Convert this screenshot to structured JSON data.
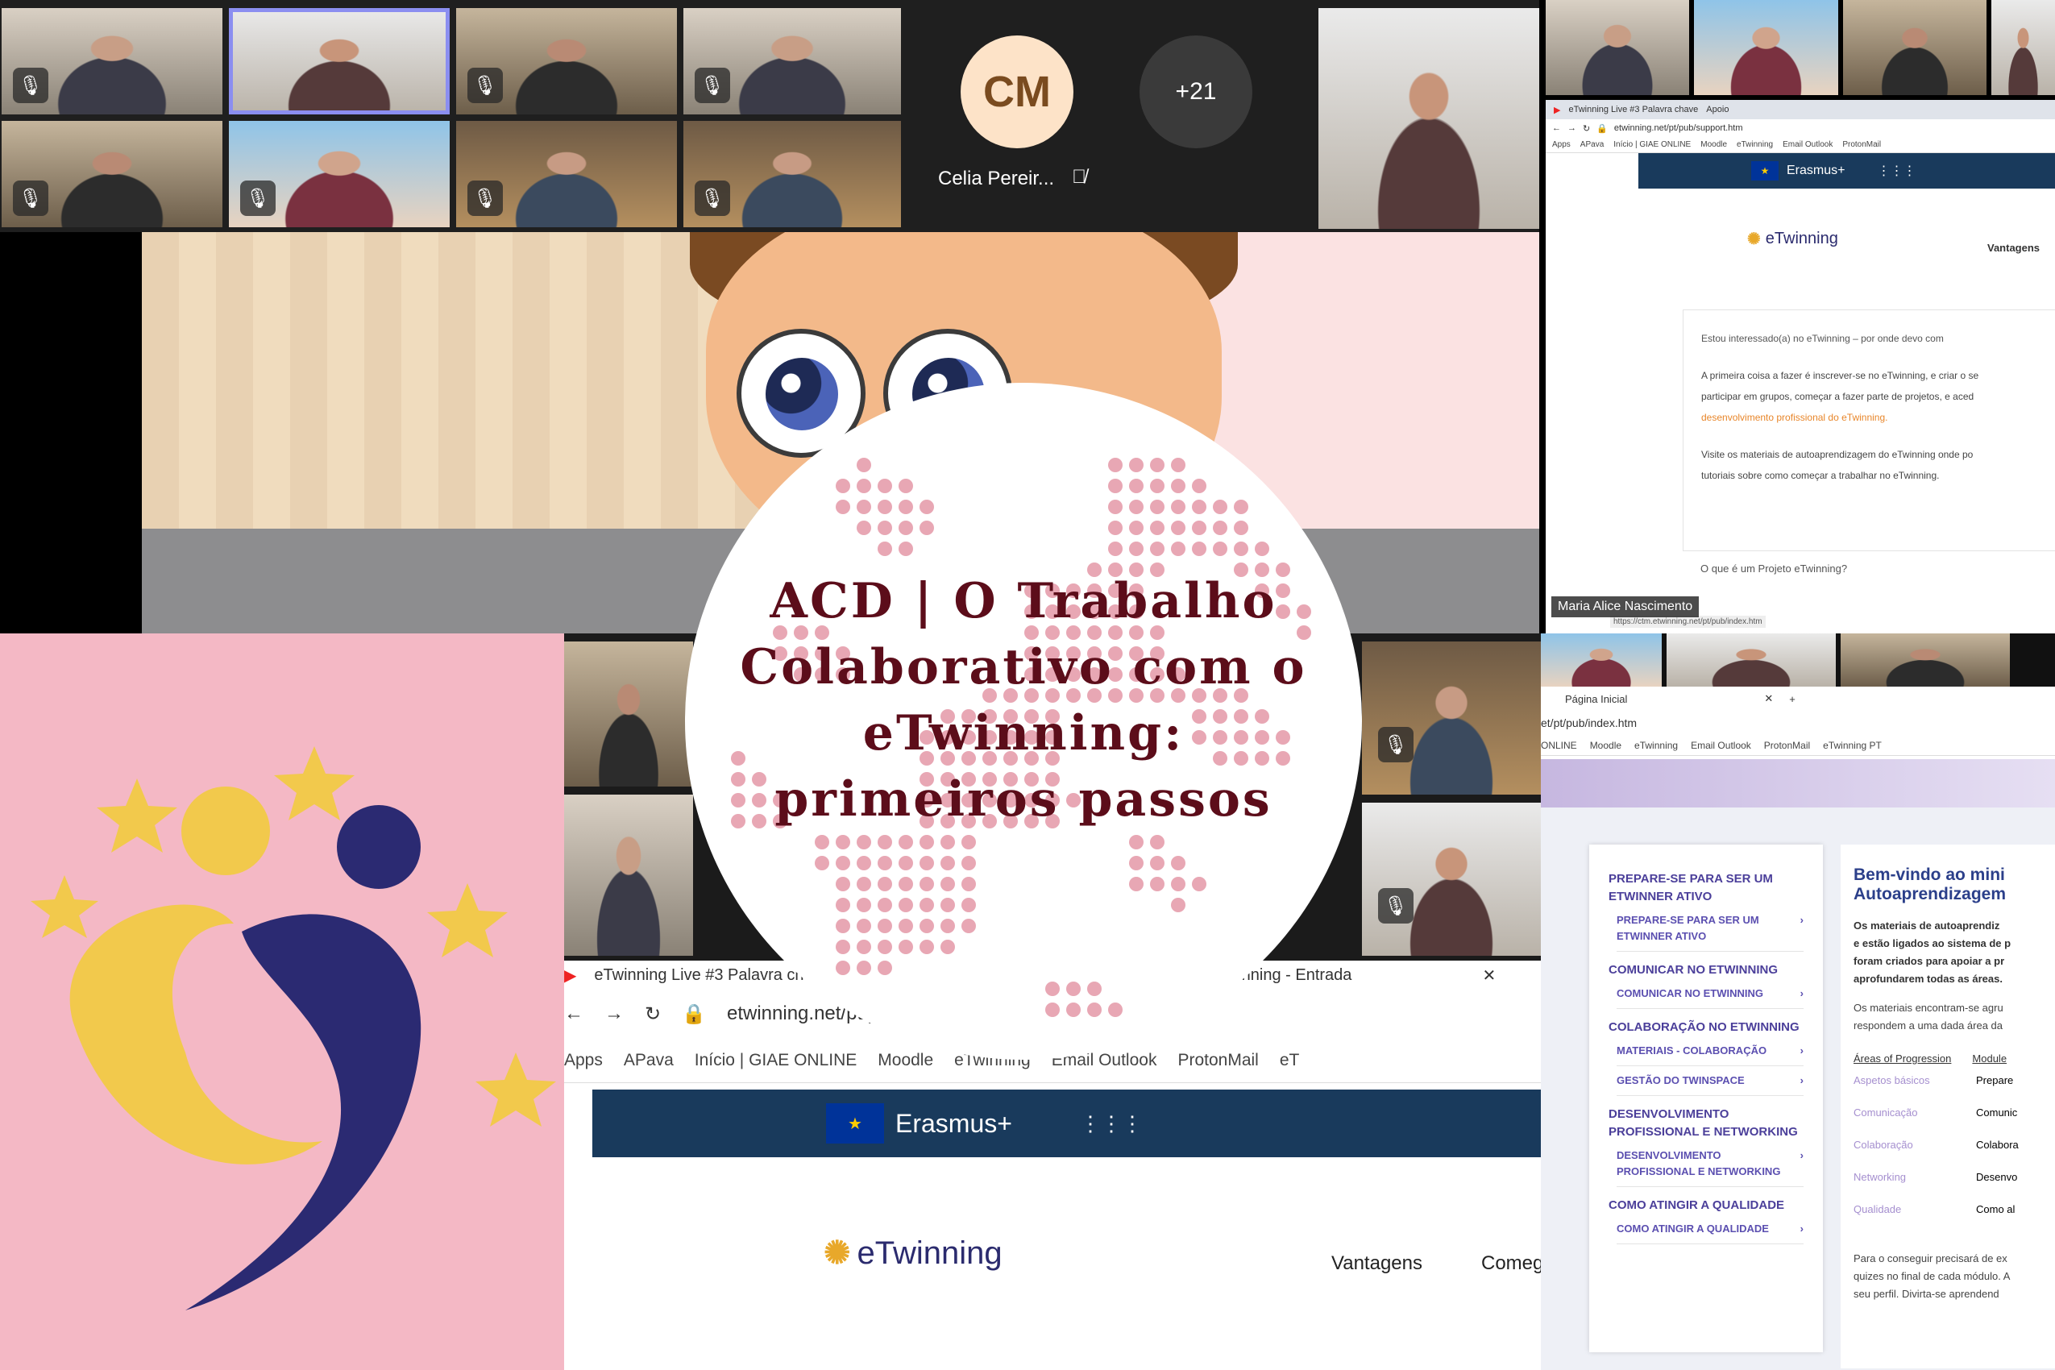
{
  "call": {
    "avatar_initials": "CM",
    "avatar_name": "Celia Pereir...",
    "more_participants": "+21",
    "presenter_name": "Maria Alice Nascimento"
  },
  "title": {
    "line1": "ACD | O Trabalho",
    "line2": "Colaborativo com o",
    "line3": "eTwinning:",
    "line4": "primeiros passos"
  },
  "browser_top": {
    "tab1": "eTwinning Live #3 Palavra chave",
    "tab2": "Apoio",
    "url": "etwinning.net/pt/pub/support.htm",
    "bookmarks": [
      "Apps",
      "APava",
      "Início | GIAE ONLINE",
      "Moodle",
      "eTwinning",
      "Email Outlook",
      "ProtonMail"
    ],
    "erasmus": "Erasmus+",
    "logo_word": "eTwinning",
    "nav_item": "Vantagens",
    "faq_question": "Estou interessado(a) no eTwinning – por onde devo com",
    "faq_p1": "A primeira coisa a fazer é inscrever-se no eTwinning, e criar o se",
    "faq_p2": "participar em grupos, começar a fazer parte de projetos, e aced",
    "faq_p3": "desenvolvimento profissional do eTwinning.",
    "faq_p4": "Visite os materiais de autoaprendizagem do eTwinning onde po",
    "faq_p5": "tutoriais sobre como começar a trabalhar no eTwinning.",
    "faq_question2": "O que é um Projeto eTwinning?",
    "status_url": "https://ctm.etwinning.net/pt/pub/index.htm"
  },
  "browser_mid": {
    "tab1": "eTwinning Live #3 Palavra ch",
    "tab2": "eTwinning - Entrada",
    "close": "✕",
    "url": "etwinning.net/pt/p",
    "bookmarks": [
      "Apps",
      "APava",
      "Início | GIAE ONLINE",
      "Moodle",
      "eTwinning",
      "Email Outlook",
      "ProtonMail",
      "eT"
    ],
    "erasmus": "Erasmus+",
    "logo_word": "eTwinning",
    "nav1": "Vantagens",
    "nav2": "Comeg"
  },
  "browser_br": {
    "tab": "Página Inicial",
    "plus": "+",
    "url": "et/pt/pub/index.htm",
    "bookmarks": [
      "ONLINE",
      "Moodle",
      "eTwinning",
      "Email Outlook",
      "ProtonMail",
      "eTwinning PT"
    ],
    "menu": [
      {
        "section": "PREPARE-SE PARA SER UM ETWINNER ATIVO",
        "items": [
          "PREPARE-SE PARA SER UM ETWINNER ATIVO"
        ]
      },
      {
        "section": "COMUNICAR NO ETWINNING",
        "items": [
          "COMUNICAR NO ETWINNING"
        ]
      },
      {
        "section": "COLABORAÇÃO NO ETWINNING",
        "items": [
          "MATERIAIS - COLABORAÇÃO",
          "GESTÃO DO TWINSPACE"
        ]
      },
      {
        "section": "DESENVOLVIMENTO PROFISSIONAL E NETWORKING",
        "items": [
          "DESENVOLVIMENTO PROFISSIONAL E NETWORKING"
        ]
      },
      {
        "section": "COMO ATINGIR A QUALIDADE",
        "items": [
          "COMO ATINGIR A QUALIDADE"
        ]
      }
    ],
    "welcome_title1": "Bem-vindo ao mini",
    "welcome_title2": "Autoaprendizagem",
    "welcome_p1": "Os materiais de autoaprendiz",
    "welcome_p2": "e estão ligados ao sistema de p",
    "welcome_p3": "foram criados para apoiar a pr",
    "welcome_p4": "aprofundarem todas as áreas.",
    "welcome_p5": "Os materiais encontram-se agru",
    "welcome_p6": "respondem a uma dada área da",
    "table_head1": "Áreas of Progression",
    "table_head2": "Module",
    "table_rows": [
      [
        "Aspetos básicos",
        "Prepare"
      ],
      [
        "Comunicação",
        "Comunic"
      ],
      [
        "Colaboração",
        "Colabora"
      ],
      [
        "Networking",
        "Desenvo"
      ],
      [
        "Qualidade",
        "Como al"
      ]
    ],
    "footer1": "Para o conseguir precisará de ex",
    "footer2": "quizes no final de cada módulo. A",
    "footer3": "seu perfil. Divirta-se aprendend"
  },
  "colors": {
    "title": "#5c0d1a",
    "dots": "#e8a7b4",
    "logo_bg": "#f4b8c5",
    "etwinning_yellow": "#f2c94c",
    "etwinning_navy": "#2b2a72",
    "erasmus_bar": "#193a5c",
    "menu_purple": "#4b3f9a"
  }
}
